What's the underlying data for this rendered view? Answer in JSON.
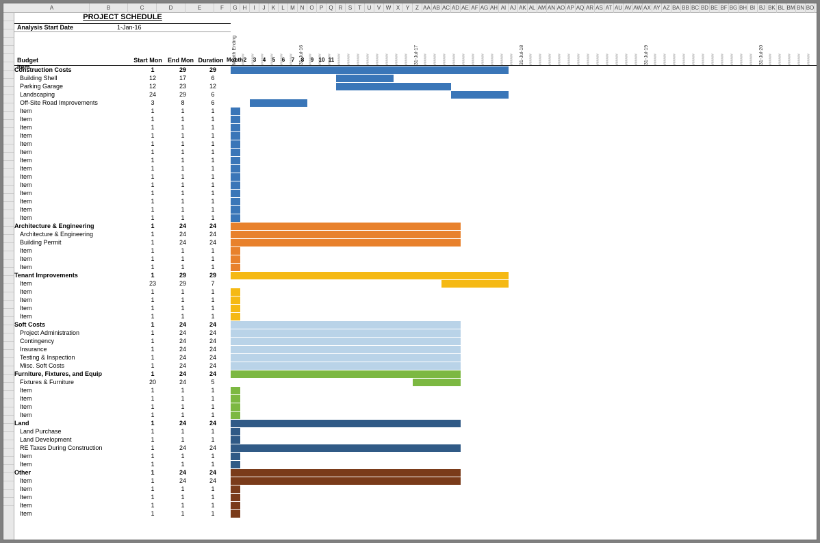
{
  "title": "PROJECT SCHEDULE",
  "analysis_label": "Analysis Start Date",
  "analysis_value": "1-Jan-16",
  "header_labels": {
    "budget_item": "Budget Item",
    "start": "Start Mon",
    "end": "End Mon",
    "dur": "Duration",
    "month": "Month"
  },
  "month_ending_label": "Month Ending",
  "month_numbers": [
    "1",
    "2",
    "3",
    "4",
    "5",
    "6",
    "7",
    "8",
    "9",
    "10",
    "11"
  ],
  "vert_markers": [
    "31-Jul-16",
    "31-Jul-17",
    "31-Jul-18",
    "31-Jul-19",
    "31-Jul-20"
  ],
  "col_letters_wide": [
    "A",
    "B",
    "C",
    "D",
    "E",
    "F"
  ],
  "col_letters_narrow": [
    "G",
    "H",
    "I",
    "J",
    "K",
    "L",
    "M",
    "N",
    "O",
    "P",
    "Q",
    "R",
    "S",
    "T",
    "U",
    "V",
    "W",
    "X",
    "Y",
    "Z",
    "AA",
    "AB",
    "AC",
    "AD",
    "AE",
    "AF",
    "AG",
    "AH",
    "AI",
    "AJ",
    "AK",
    "AL",
    "AM",
    "AN",
    "AO",
    "AP",
    "AQ",
    "AR",
    "AS",
    "AT",
    "AU",
    "AV",
    "AW",
    "AX",
    "AY",
    "AZ",
    "BA",
    "BB",
    "BC",
    "BD",
    "BE",
    "BF",
    "BG",
    "BH",
    "BI",
    "BJ",
    "BK",
    "BL",
    "BM",
    "BN",
    "BO"
  ],
  "colors": {
    "blue": "#3a76b8",
    "orange": "#e8812c",
    "gold": "#f5b914",
    "lightblue": "#b9d3e8",
    "green": "#7cb842",
    "darkblue": "#305a86",
    "brown": "#7a3b1a"
  },
  "rows": [
    {
      "name": "Construction Costs",
      "bold": true,
      "start": 1,
      "end": 29,
      "dur": 29,
      "color": "blue",
      "bar_start": 1,
      "bar_len": 29
    },
    {
      "name": "Building Shell",
      "start": 12,
      "end": 17,
      "dur": 6,
      "color": "blue",
      "bar_start": 12,
      "bar_len": 6
    },
    {
      "name": "Parking Garage",
      "start": 12,
      "end": 23,
      "dur": 12,
      "color": "blue",
      "bar_start": 12,
      "bar_len": 12
    },
    {
      "name": "Landscaping",
      "start": 24,
      "end": 29,
      "dur": 6,
      "color": "blue",
      "bar_start": 24,
      "bar_len": 6
    },
    {
      "name": "Off-Site Road Improvements",
      "start": 3,
      "end": 8,
      "dur": 6,
      "color": "blue",
      "bar_start": 3,
      "bar_len": 6
    },
    {
      "name": "Item",
      "start": 1,
      "end": 1,
      "dur": 1,
      "color": "blue",
      "bar_start": 1,
      "bar_len": 1
    },
    {
      "name": "Item",
      "start": 1,
      "end": 1,
      "dur": 1,
      "color": "blue",
      "bar_start": 1,
      "bar_len": 1
    },
    {
      "name": "Item",
      "start": 1,
      "end": 1,
      "dur": 1,
      "color": "blue",
      "bar_start": 1,
      "bar_len": 1
    },
    {
      "name": "Item",
      "start": 1,
      "end": 1,
      "dur": 1,
      "color": "blue",
      "bar_start": 1,
      "bar_len": 1
    },
    {
      "name": "Item",
      "start": 1,
      "end": 1,
      "dur": 1,
      "color": "blue",
      "bar_start": 1,
      "bar_len": 1
    },
    {
      "name": "Item",
      "start": 1,
      "end": 1,
      "dur": 1,
      "color": "blue",
      "bar_start": 1,
      "bar_len": 1
    },
    {
      "name": "Item",
      "start": 1,
      "end": 1,
      "dur": 1,
      "color": "blue",
      "bar_start": 1,
      "bar_len": 1
    },
    {
      "name": "Item",
      "start": 1,
      "end": 1,
      "dur": 1,
      "color": "blue",
      "bar_start": 1,
      "bar_len": 1
    },
    {
      "name": "Item",
      "start": 1,
      "end": 1,
      "dur": 1,
      "color": "blue",
      "bar_start": 1,
      "bar_len": 1
    },
    {
      "name": "Item",
      "start": 1,
      "end": 1,
      "dur": 1,
      "color": "blue",
      "bar_start": 1,
      "bar_len": 1
    },
    {
      "name": "Item",
      "start": 1,
      "end": 1,
      "dur": 1,
      "color": "blue",
      "bar_start": 1,
      "bar_len": 1
    },
    {
      "name": "Item",
      "start": 1,
      "end": 1,
      "dur": 1,
      "color": "blue",
      "bar_start": 1,
      "bar_len": 1
    },
    {
      "name": "Item",
      "start": 1,
      "end": 1,
      "dur": 1,
      "color": "blue",
      "bar_start": 1,
      "bar_len": 1
    },
    {
      "name": "Item",
      "start": 1,
      "end": 1,
      "dur": 1,
      "color": "blue",
      "bar_start": 1,
      "bar_len": 1
    },
    {
      "name": "Architecture & Engineering",
      "bold": true,
      "start": 1,
      "end": 24,
      "dur": 24,
      "color": "orange",
      "bar_start": 1,
      "bar_len": 24
    },
    {
      "name": "Architecture & Engineering",
      "start": 1,
      "end": 24,
      "dur": 24,
      "color": "orange",
      "bar_start": 1,
      "bar_len": 24
    },
    {
      "name": "Building Permit",
      "start": 1,
      "end": 24,
      "dur": 24,
      "color": "orange",
      "bar_start": 1,
      "bar_len": 24
    },
    {
      "name": "Item",
      "start": 1,
      "end": 1,
      "dur": 1,
      "color": "orange",
      "bar_start": 1,
      "bar_len": 1
    },
    {
      "name": "Item",
      "start": 1,
      "end": 1,
      "dur": 1,
      "color": "orange",
      "bar_start": 1,
      "bar_len": 1
    },
    {
      "name": "Item",
      "start": 1,
      "end": 1,
      "dur": 1,
      "color": "orange",
      "bar_start": 1,
      "bar_len": 1
    },
    {
      "name": "Tenant Improvements",
      "bold": true,
      "start": 1,
      "end": 29,
      "dur": 29,
      "color": "gold",
      "bar_start": 1,
      "bar_len": 29
    },
    {
      "name": "Item",
      "start": 23,
      "end": 29,
      "dur": 7,
      "color": "gold",
      "bar_start": 23,
      "bar_len": 7
    },
    {
      "name": "Item",
      "start": 1,
      "end": 1,
      "dur": 1,
      "color": "gold",
      "bar_start": 1,
      "bar_len": 1
    },
    {
      "name": "Item",
      "start": 1,
      "end": 1,
      "dur": 1,
      "color": "gold",
      "bar_start": 1,
      "bar_len": 1
    },
    {
      "name": "Item",
      "start": 1,
      "end": 1,
      "dur": 1,
      "color": "gold",
      "bar_start": 1,
      "bar_len": 1
    },
    {
      "name": "Item",
      "start": 1,
      "end": 1,
      "dur": 1,
      "color": "gold",
      "bar_start": 1,
      "bar_len": 1
    },
    {
      "name": "Soft Costs",
      "bold": true,
      "start": 1,
      "end": 24,
      "dur": 24,
      "color": "lightblue",
      "bar_start": 1,
      "bar_len": 24
    },
    {
      "name": "Project Administration",
      "start": 1,
      "end": 24,
      "dur": 24,
      "color": "lightblue",
      "bar_start": 1,
      "bar_len": 24
    },
    {
      "name": "Contingency",
      "start": 1,
      "end": 24,
      "dur": 24,
      "color": "lightblue",
      "bar_start": 1,
      "bar_len": 24
    },
    {
      "name": "Insurance",
      "start": 1,
      "end": 24,
      "dur": 24,
      "color": "lightblue",
      "bar_start": 1,
      "bar_len": 24
    },
    {
      "name": "Testing & Inspection",
      "start": 1,
      "end": 24,
      "dur": 24,
      "color": "lightblue",
      "bar_start": 1,
      "bar_len": 24
    },
    {
      "name": "Misc. Soft Costs",
      "start": 1,
      "end": 24,
      "dur": 24,
      "color": "lightblue",
      "bar_start": 1,
      "bar_len": 24
    },
    {
      "name": "Furniture, Fixtures, and Equip",
      "bold": true,
      "start": 1,
      "end": 24,
      "dur": 24,
      "color": "green",
      "bar_start": 1,
      "bar_len": 24
    },
    {
      "name": "Fixtures & Furniture",
      "start": 20,
      "end": 24,
      "dur": 5,
      "color": "green",
      "bar_start": 20,
      "bar_len": 5
    },
    {
      "name": "Item",
      "start": 1,
      "end": 1,
      "dur": 1,
      "color": "green",
      "bar_start": 1,
      "bar_len": 1
    },
    {
      "name": "Item",
      "start": 1,
      "end": 1,
      "dur": 1,
      "color": "green",
      "bar_start": 1,
      "bar_len": 1
    },
    {
      "name": "Item",
      "start": 1,
      "end": 1,
      "dur": 1,
      "color": "green",
      "bar_start": 1,
      "bar_len": 1
    },
    {
      "name": "Item",
      "start": 1,
      "end": 1,
      "dur": 1,
      "color": "green",
      "bar_start": 1,
      "bar_len": 1
    },
    {
      "name": "Land",
      "bold": true,
      "start": 1,
      "end": 24,
      "dur": 24,
      "color": "darkblue",
      "bar_start": 1,
      "bar_len": 24
    },
    {
      "name": "Land Purchase",
      "start": 1,
      "end": 1,
      "dur": 1,
      "color": "darkblue",
      "bar_start": 1,
      "bar_len": 1
    },
    {
      "name": "Land Development",
      "start": 1,
      "end": 1,
      "dur": 1,
      "color": "darkblue",
      "bar_start": 1,
      "bar_len": 1
    },
    {
      "name": "RE Taxes During Construction",
      "start": 1,
      "end": 24,
      "dur": 24,
      "color": "darkblue",
      "bar_start": 1,
      "bar_len": 24
    },
    {
      "name": "Item",
      "start": 1,
      "end": 1,
      "dur": 1,
      "color": "darkblue",
      "bar_start": 1,
      "bar_len": 1
    },
    {
      "name": "Item",
      "start": 1,
      "end": 1,
      "dur": 1,
      "color": "darkblue",
      "bar_start": 1,
      "bar_len": 1
    },
    {
      "name": "Other",
      "bold": true,
      "start": 1,
      "end": 24,
      "dur": 24,
      "color": "brown",
      "bar_start": 1,
      "bar_len": 24
    },
    {
      "name": "Item",
      "start": 1,
      "end": 24,
      "dur": 24,
      "color": "brown",
      "bar_start": 1,
      "bar_len": 24
    },
    {
      "name": "Item",
      "start": 1,
      "end": 1,
      "dur": 1,
      "color": "brown",
      "bar_start": 1,
      "bar_len": 1
    },
    {
      "name": "Item",
      "start": 1,
      "end": 1,
      "dur": 1,
      "color": "brown",
      "bar_start": 1,
      "bar_len": 1
    },
    {
      "name": "Item",
      "start": 1,
      "end": 1,
      "dur": 1,
      "color": "brown",
      "bar_start": 1,
      "bar_len": 1
    },
    {
      "name": "Item",
      "start": 1,
      "end": 1,
      "dur": 1,
      "color": "brown",
      "bar_start": 1,
      "bar_len": 1
    }
  ]
}
